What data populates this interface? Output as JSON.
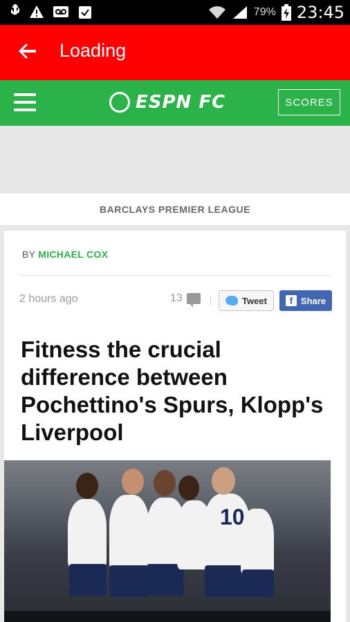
{
  "status_bar": {
    "battery": "79%",
    "time": "23:45"
  },
  "app_bar": {
    "title": "Loading"
  },
  "espn_bar": {
    "logo_text": "ESPN FC",
    "scores_label": "SCORES"
  },
  "league": {
    "name": "BARCLAYS PREMIER LEAGUE"
  },
  "article": {
    "by_prefix": "BY",
    "author": "MICHAEL COX",
    "time_ago": "2 hours ago",
    "comment_count": "13",
    "tweet_label": "Tweet",
    "share_label": "Share",
    "headline": "Fitness the crucial difference between Pochettino's Spurs, Klopp's Liverpool"
  },
  "colors": {
    "app_bar": "#ff0000",
    "espn_green": "#2bb34a",
    "facebook": "#4267b2",
    "twitter": "#55acee"
  }
}
